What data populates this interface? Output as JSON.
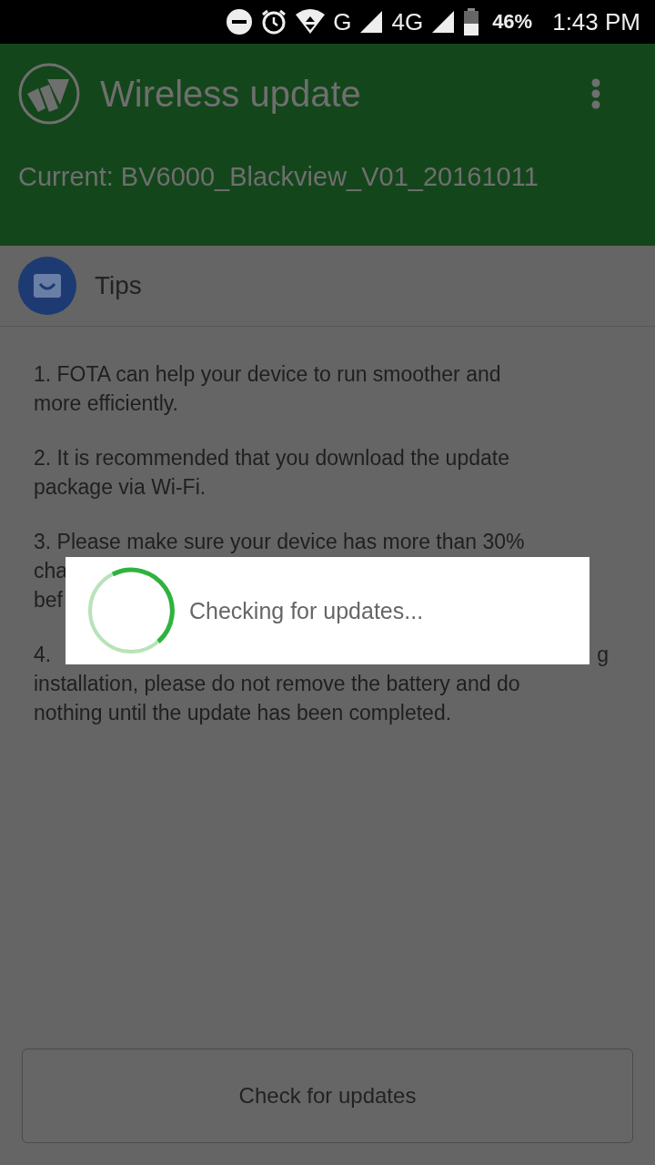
{
  "status_bar": {
    "network": [
      "G",
      "4G"
    ],
    "battery": "46%",
    "time": "1:43 PM"
  },
  "app_bar": {
    "title": "Wireless update",
    "current": "Current: BV6000_Blackview_V01_20161011"
  },
  "tips": {
    "title": "Tips",
    "paragraphs": [
      {
        "lines": [
          {
            "text": "1. FOTA can help your device to run smoother and"
          },
          {
            "text": "more efficiently."
          }
        ]
      },
      {
        "lines": [
          {
            "text": "2. It is recommended that you download the update"
          },
          {
            "text": "package via Wi-Fi."
          }
        ]
      },
      {
        "lines": [
          {
            "text": "3. Please make sure your device has more than 30%"
          },
          {
            "text": "cha"
          },
          {
            "text": "bef"
          }
        ]
      },
      {
        "lines": [
          {
            "text": "4.",
            "right": "g"
          },
          {
            "text": "installation, please do not remove the battery and do"
          },
          {
            "text": "nothing until the update has been completed."
          }
        ]
      }
    ]
  },
  "dialog": {
    "message": "Checking for updates..."
  },
  "button": {
    "label": "Check for updates"
  }
}
